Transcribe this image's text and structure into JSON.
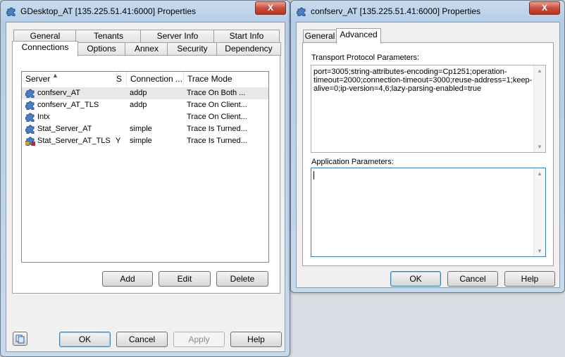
{
  "left_window": {
    "title": "GDesktop_AT [135.225.51.41:6000] Properties",
    "close": "X",
    "tabs_row1": [
      "General",
      "Tenants",
      "Server Info",
      "Start Info"
    ],
    "tabs_row2": [
      "Connections",
      "Options",
      "Annex",
      "Security",
      "Dependency"
    ],
    "columns": [
      "Server",
      "S",
      "Connection ...",
      "Trace Mode"
    ],
    "rows": [
      {
        "server": "confserv_AT",
        "s": "",
        "connection": "addp",
        "trace": "Trace On Both ..."
      },
      {
        "server": "confserv_AT_TLS",
        "s": "",
        "connection": "addp",
        "trace": "Trace On Client..."
      },
      {
        "server": "Intx",
        "s": "",
        "connection": "",
        "trace": "Trace On Client..."
      },
      {
        "server": "Stat_Server_AT",
        "s": "",
        "connection": "simple",
        "trace": "Trace Is Turned..."
      },
      {
        "server": "Stat_Server_AT_TLS",
        "s": "Y",
        "connection": "simple",
        "trace": "Trace Is Turned..."
      }
    ],
    "buttons": {
      "add": "Add",
      "edit": "Edit",
      "delete": "Delete",
      "ok": "OK",
      "cancel": "Cancel",
      "apply": "Apply",
      "help": "Help"
    }
  },
  "right_window": {
    "title": "confserv_AT [135.225.51.41:6000] Properties",
    "close": "X",
    "tabs": [
      "General",
      "Advanced"
    ],
    "transport_label": "Transport Protocol Parameters:",
    "transport_value": "port=3005;string-attributes-encoding=Cp1251;operation-timeout=2000;connection-timeout=3000;reuse-address=1;keep-alive=0;ip-version=4,6;lazy-parsing-enabled=true",
    "application_label": "Application Parameters:",
    "application_value": "",
    "buttons": {
      "ok": "OK",
      "cancel": "Cancel",
      "help": "Help"
    }
  }
}
